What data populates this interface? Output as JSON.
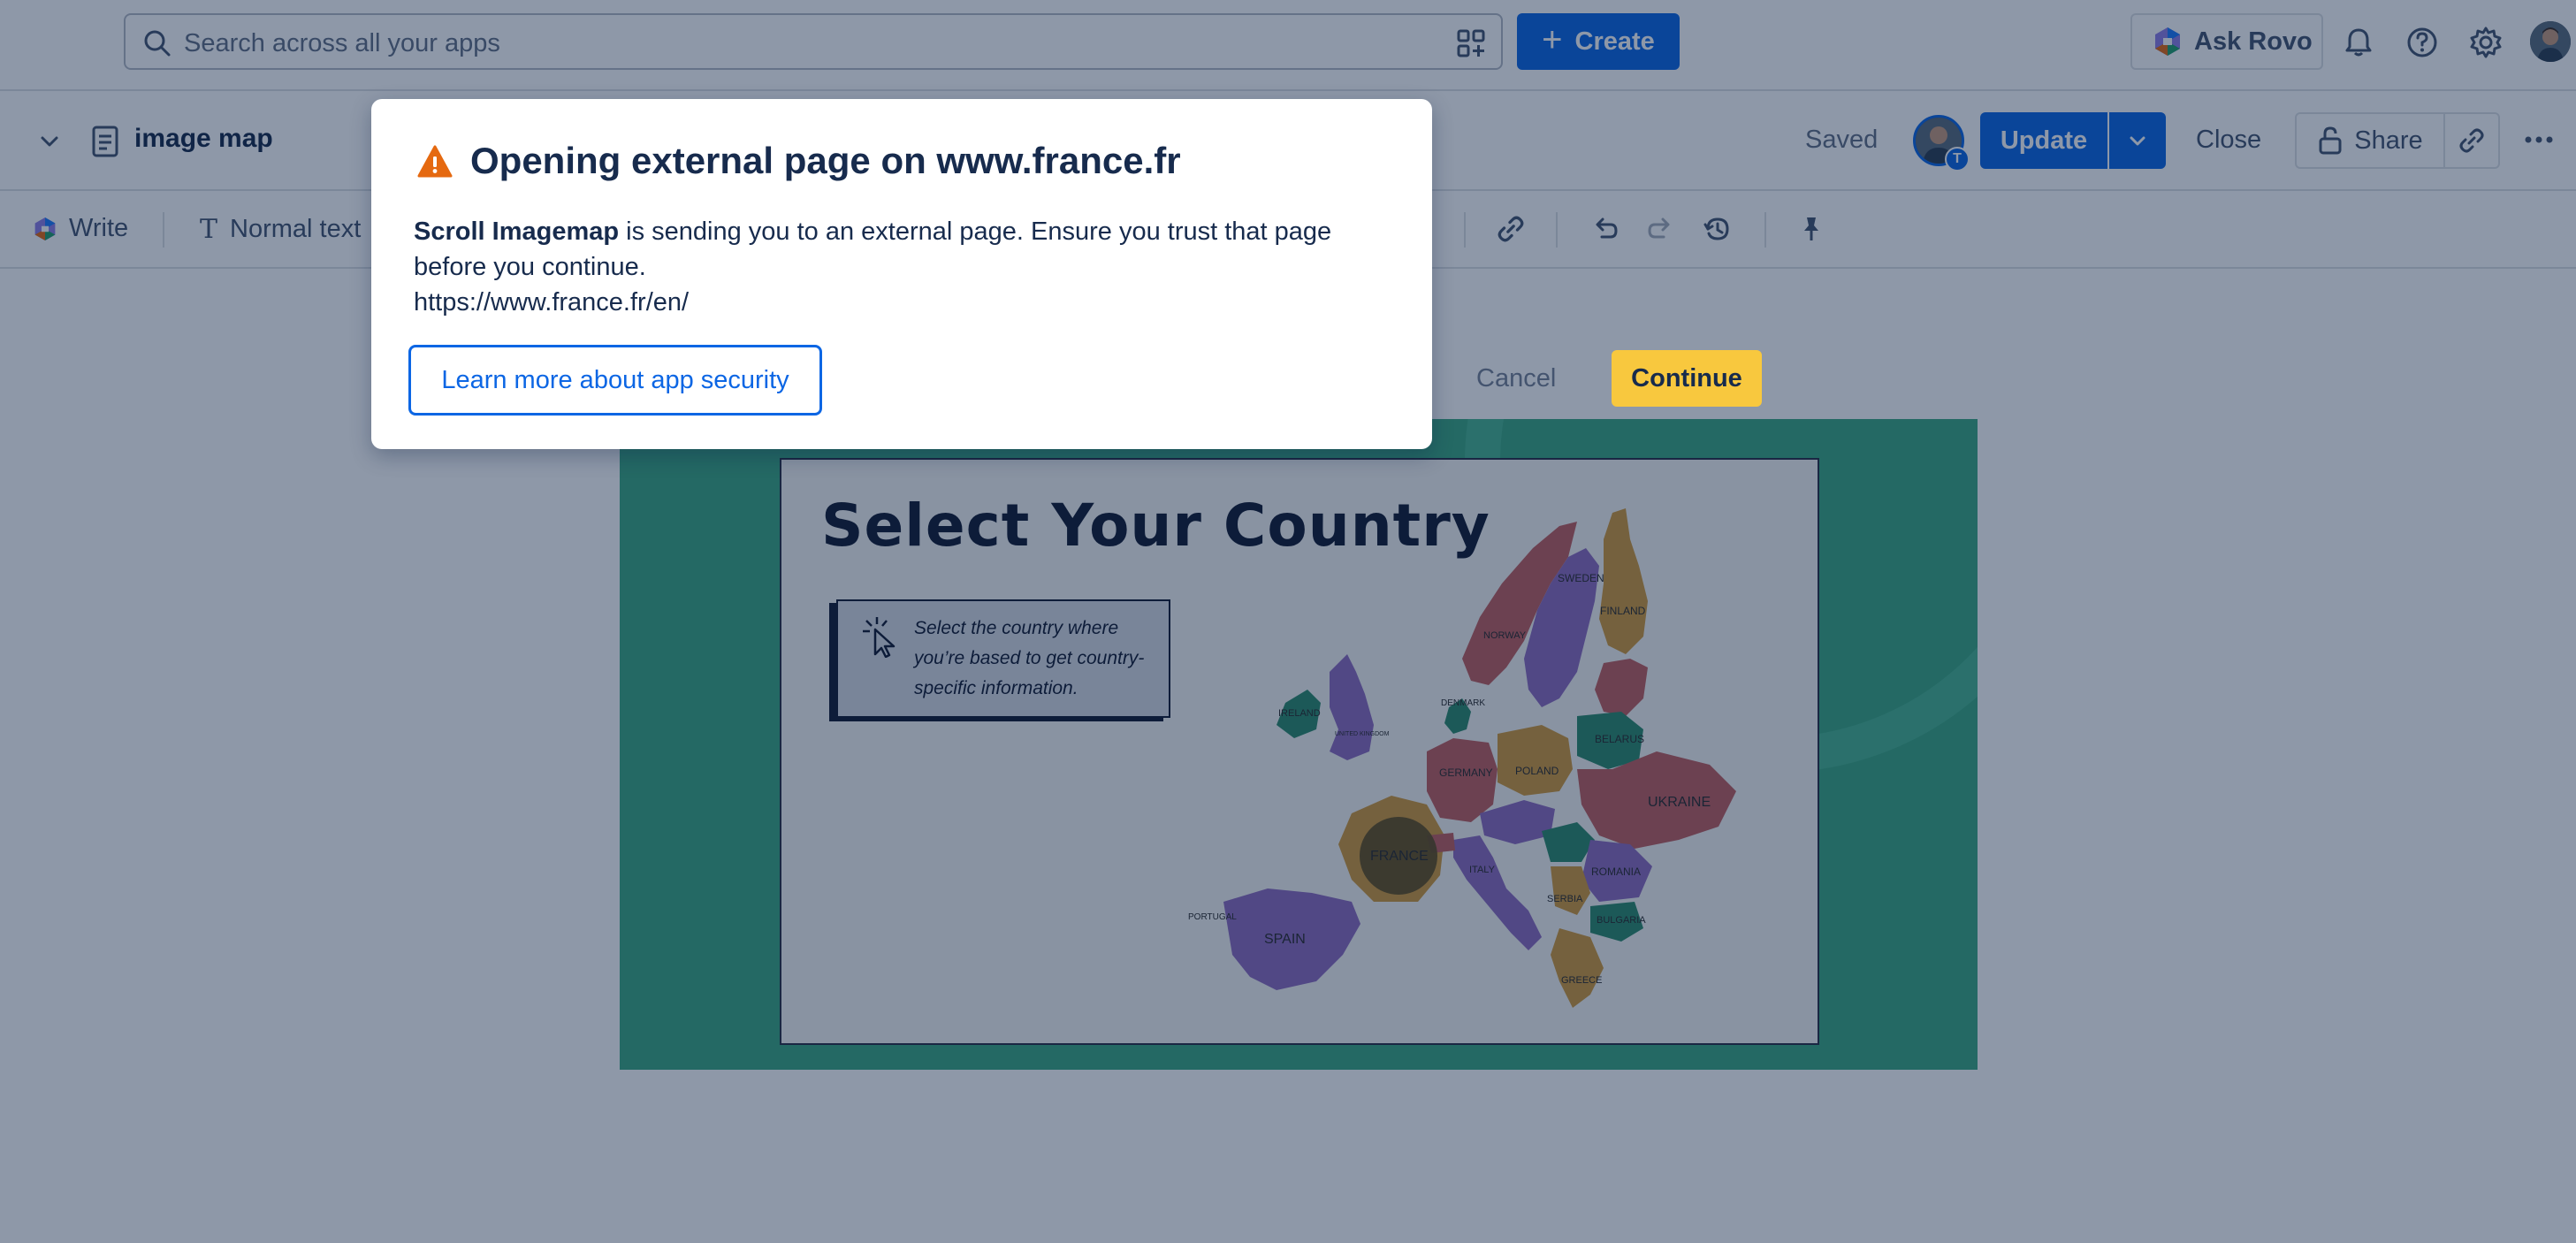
{
  "topnav": {
    "search_placeholder": "Search across all your apps",
    "create_label": "Create",
    "ask_rovo_label": "Ask Rovo"
  },
  "page": {
    "title": "image map",
    "saved_label": "Saved",
    "update_label": "Update",
    "close_label": "Close",
    "share_label": "Share"
  },
  "toolbar": {
    "write_label": "Write",
    "text_style_label": "Normal text"
  },
  "image_map": {
    "heading": "Select Your Country",
    "instruction": "Select the country where you’re based to get country-specific information.",
    "countries": {
      "sweden": "SWEDEN",
      "finland": "FINLAND",
      "norway": "NORWAY",
      "ireland": "IRELAND",
      "united_kingdom": "UNITED KINGDOM",
      "denmark": "DENMARK",
      "germany": "GERMANY",
      "poland": "POLAND",
      "belarus": "BELARUS",
      "ukraine": "UKRAINE",
      "france": "FRANCE",
      "italy": "ITALY",
      "romania": "ROMANIA",
      "serbia": "SERBIA",
      "bulgaria": "BULGARIA",
      "greece": "GREECE",
      "spain": "SPAIN",
      "portugal": "PORTUGAL"
    }
  },
  "dialog": {
    "title": "Opening external page on www.france.fr",
    "app_name": "Scroll Imagemap",
    "message": " is sending you to an external page. Ensure you trust that page before you continue.",
    "url": "https://www.france.fr/en/",
    "learn_more_label": "Learn more about app security",
    "cancel_label": "Cancel",
    "continue_label": "Continue"
  },
  "colors": {
    "primary": "#0c66e4",
    "warning": "#e56910",
    "continue_button": "#f8c83e",
    "map_background": "#3ba882"
  }
}
